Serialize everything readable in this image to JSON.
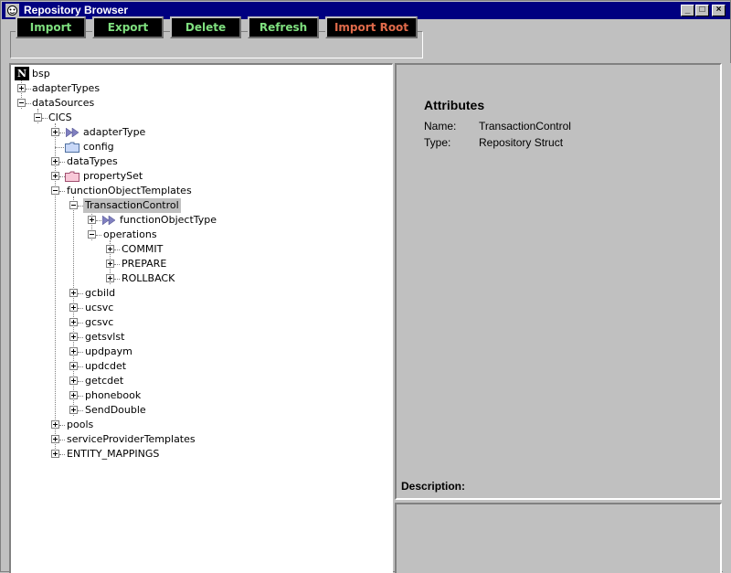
{
  "window": {
    "title": "Repository Browser",
    "min_symbol": "_",
    "max_symbol": "□",
    "close_symbol": "×"
  },
  "toolbar": {
    "buttons": [
      {
        "label": "Import",
        "color": "#6ee86e"
      },
      {
        "label": "Export",
        "color": "#6ee86e"
      },
      {
        "label": "Delete",
        "color": "#6ee86e"
      },
      {
        "label": "Refresh",
        "color": "#6ee86e"
      },
      {
        "label": "Import Root",
        "color": "#e06a4a"
      }
    ]
  },
  "tree": {
    "root_icon_letter": "N",
    "nodes": [
      {
        "label": "bsp"
      },
      {
        "label": "adapterTypes"
      },
      {
        "label": "dataSources"
      },
      {
        "label": "CICS"
      },
      {
        "label": "adapterType"
      },
      {
        "label": "config"
      },
      {
        "label": "dataTypes"
      },
      {
        "label": "propertySet"
      },
      {
        "label": "functionObjectTemplates"
      },
      {
        "label": "TransactionControl"
      },
      {
        "label": "functionObjectType"
      },
      {
        "label": "operations"
      },
      {
        "label": "COMMIT"
      },
      {
        "label": "PREPARE"
      },
      {
        "label": "ROLLBACK"
      },
      {
        "label": "gcbild"
      },
      {
        "label": "ucsvc"
      },
      {
        "label": "gcsvc"
      },
      {
        "label": "getsvlst"
      },
      {
        "label": "updpaym"
      },
      {
        "label": "updcdet"
      },
      {
        "label": "getcdet"
      },
      {
        "label": "phonebook"
      },
      {
        "label": "SendDouble"
      },
      {
        "label": "pools"
      },
      {
        "label": "serviceProviderTemplates"
      },
      {
        "label": "ENTITY_MAPPINGS"
      }
    ]
  },
  "attributes": {
    "title": "Attributes",
    "rows": [
      {
        "key": "Name:",
        "value": "TransactionControl"
      },
      {
        "key": "Type:",
        "value": "Repository Struct"
      }
    ],
    "description_label": "Description:"
  }
}
